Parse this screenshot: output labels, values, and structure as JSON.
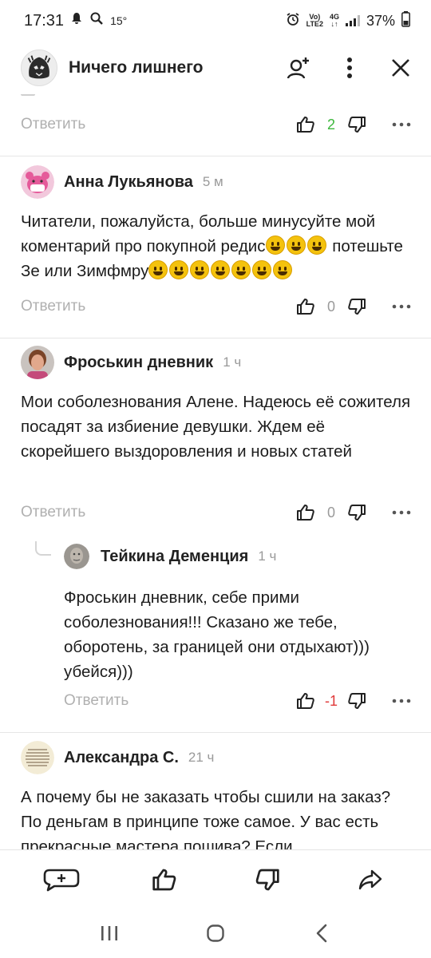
{
  "status_bar": {
    "time": "17:31",
    "temperature": "15°",
    "net_top": "Vo)",
    "net_bottom": "LTE2",
    "network_type": "4G",
    "battery": "37%"
  },
  "header": {
    "channel_name": "Ничего лишнего"
  },
  "feed": {
    "reply_label": "Ответить",
    "top_row": {
      "likes": "2"
    },
    "comments": [
      {
        "author": "Анна Лукьянова",
        "time": "5 м",
        "text_parts": [
          "Читатели, пожалуйста, больше минусуйте мой коментарий про покупной редис",
          "потешьте Зе или Зимфмру"
        ],
        "likes": "0"
      },
      {
        "author": "Фроськин дневник",
        "time": "1 ч",
        "text": "Мои соболезнования Алене. Надеюсь её сожителя посадят за избиение девушки. Ждем её скорейшего выздоровления и новых статей",
        "likes": "0",
        "reply": {
          "author": "Тейкина Деменция",
          "time": "1 ч",
          "text": "Фроськин дневник, себе прими соболезнования!!! Сказано же тебе, оборотень, за границей они отдыхают))) убейся)))",
          "likes": "-1"
        }
      },
      {
        "author": "Александра С.",
        "time": "21 ч",
        "text": "А почему бы не заказать чтобы сшили на заказ? По деньгам в принципе тоже самое. У вас есть прекрасные мастера пошива? Если"
      }
    ]
  },
  "icons": {
    "like": "thumb-up-icon",
    "dislike": "thumb-down-icon",
    "more": "more-dots-icon",
    "add_user": "add-user-icon",
    "menu": "vertical-dots-icon",
    "close": "close-icon",
    "comment": "add-comment-icon",
    "share": "share-icon"
  },
  "colors": {
    "positive": "#3cb73c",
    "negative": "#e03a3a",
    "muted": "#b0b0b0"
  }
}
